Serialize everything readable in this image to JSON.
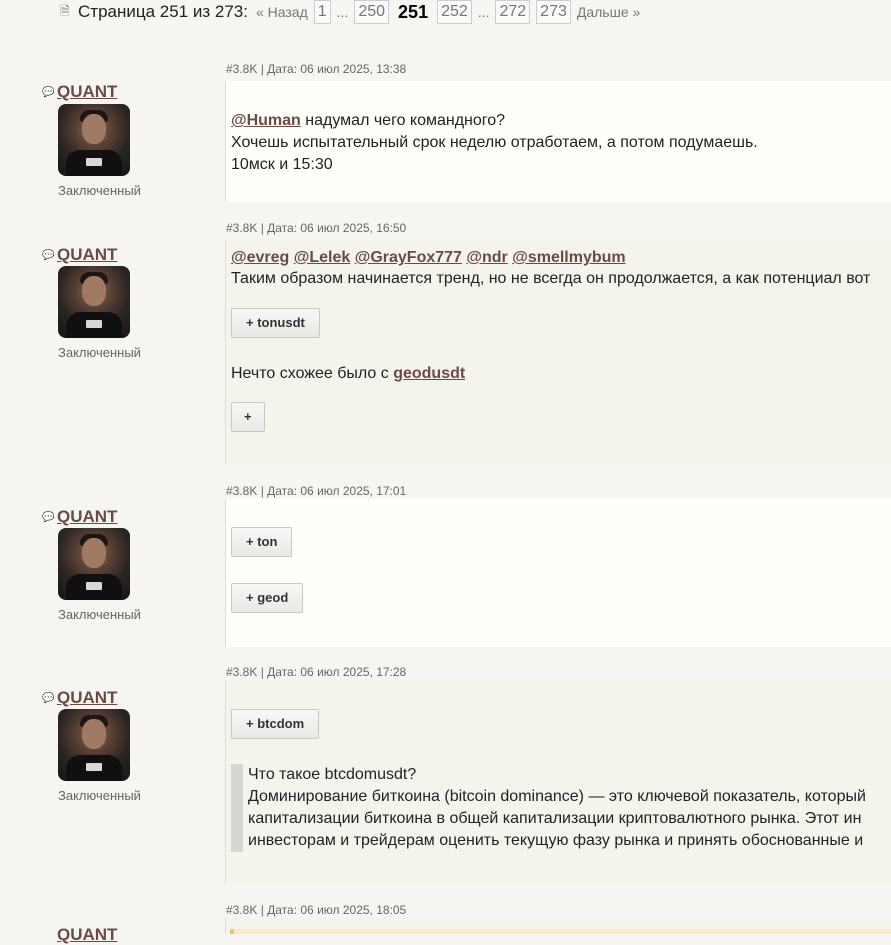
{
  "pager": {
    "page_label": "Страница 251 из 273:",
    "prev_label": "« Назад",
    "next_label": "Дальше »",
    "ellipsis": "...",
    "pages": [
      "1",
      "250",
      "251",
      "252",
      "272",
      "273"
    ],
    "current": "251"
  },
  "posts": [
    {
      "meta": "#3.8K | Дата: 06 июл 2025, 13:38",
      "author": "QUANT",
      "status": "Заключенный",
      "mention": "@Human",
      "line1_rest": " надумал чего командного?",
      "line2": "Хочешь испытательный срок неделю отработаем, а потом подумаешь.",
      "line3": "10мск и 15:30"
    },
    {
      "meta": "#3.8K | Дата: 06 июл 2025, 16:50",
      "author": "QUANT",
      "status": "Заключенный",
      "mentions": [
        "@evreg",
        "@Lelek",
        "@GrayFox777",
        "@ndr",
        "@smellmybum"
      ],
      "line2": "Таким образом начинается тренд, но не всегда он продолжается, а как потенциал вот",
      "spoiler1": "+ tonusdt",
      "line3_prefix": "Нечто схожее было с ",
      "link": "geodusdt",
      "spoiler2": "+"
    },
    {
      "meta": "#3.8K | Дата: 06 июл 2025, 17:01",
      "author": "QUANT",
      "status": "Заключенный",
      "spoiler1": "+ ton",
      "spoiler2": "+ geod"
    },
    {
      "meta": "#3.8K | Дата: 06 июл 2025, 17:28",
      "author": "QUANT",
      "status": "Заключенный",
      "spoiler1": "+ btcdom",
      "quote": [
        "Что такое btcdomusdt?",
        "Доминирование биткоина (bitcoin dominance) — это ключевой показатель, который",
        "капитализации биткоина в общей капитализации криптовалютного рынка. Этот ин",
        "инвесторам и трейдерам оценить текущую фазу рынка и принять обоснованные и"
      ]
    },
    {
      "meta": "#3.8K | Дата: 06 июл 2025, 18:05",
      "author": "QUANT"
    }
  ],
  "colors": {
    "accent": "#6b4a46",
    "page_bg": "#f6f5f1",
    "post_bg": "#fefefa",
    "post_tint": "#f4f4ec"
  },
  "icons": {
    "pager": "document-icon",
    "author": "speech-bubble-icon"
  }
}
